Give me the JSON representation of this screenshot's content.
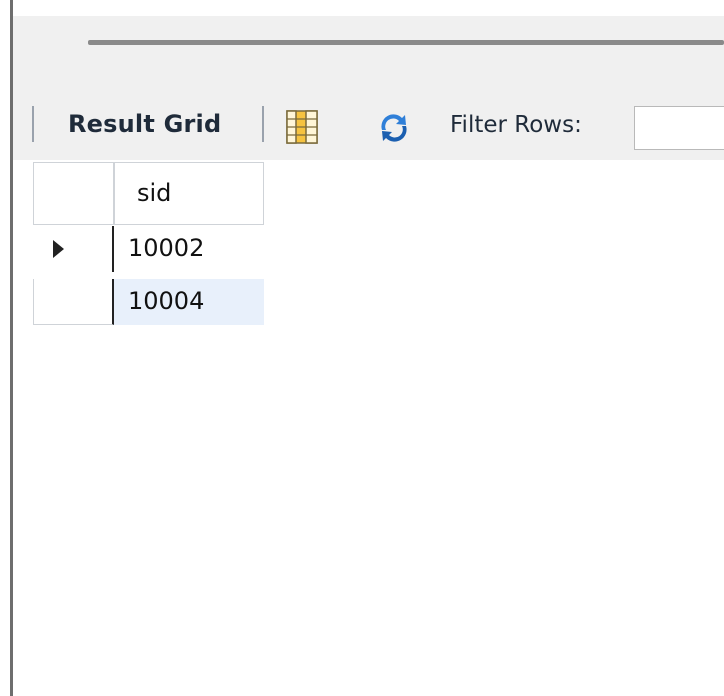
{
  "toolbar": {
    "result_grid_label": "Result Grid",
    "filter_rows_label": "Filter Rows:",
    "filter_value": "",
    "icons": [
      "columns-icon",
      "refresh-icon"
    ]
  },
  "grid": {
    "columns": [
      "sid"
    ],
    "rows": [
      {
        "sid": "10002",
        "current": true
      },
      {
        "sid": "10004",
        "current": false
      }
    ]
  },
  "colors": {
    "panel": "#f0f0f0",
    "selected_row": "#e8f0fb",
    "text": "#1f2b3a"
  }
}
